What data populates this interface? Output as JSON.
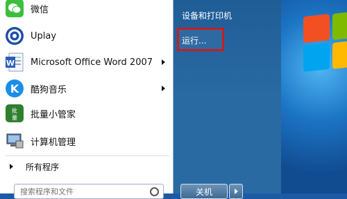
{
  "start_menu": {
    "programs": [
      {
        "label": "微信",
        "icon": "wechat-icon",
        "has_submenu": false
      },
      {
        "label": "Uplay",
        "icon": "uplay-icon",
        "has_submenu": false
      },
      {
        "label": "Microsoft Office Word 2007",
        "icon": "word-icon",
        "has_submenu": true
      },
      {
        "label": "酷狗音乐",
        "icon": "kugou-icon",
        "has_submenu": true
      },
      {
        "label": "批量小管家",
        "icon": "batch-manager-icon",
        "has_submenu": false
      },
      {
        "label": "计算机管理",
        "icon": "computer-management-icon",
        "has_submenu": false
      }
    ],
    "all_programs": "所有程序",
    "search_placeholder": "搜索程序和文件",
    "right_items": [
      "设备和打印机",
      "运行..."
    ],
    "shutdown_label": "关机"
  },
  "colors": {
    "highlight_box": "#c81e1e",
    "right_pane": "#2a6aa3"
  }
}
